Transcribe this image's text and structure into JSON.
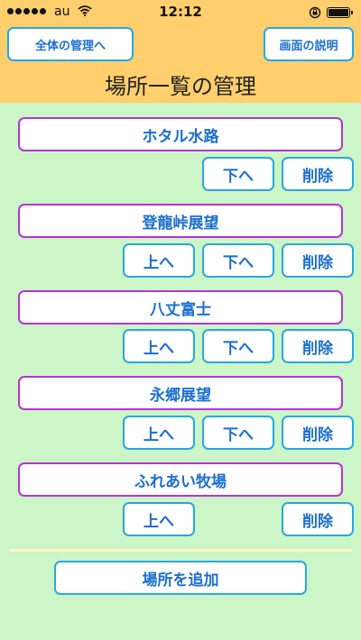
{
  "status_bar": {
    "carrier": "au",
    "time": "12:12",
    "battery_level": 1.0
  },
  "header": {
    "manage_all_button": "全体の管理へ",
    "screen_help_button": "画面の説明",
    "title": "場所一覧の管理"
  },
  "places": [
    {
      "name": "ホタル水路",
      "up_label": "",
      "down_label": "下へ",
      "delete_label": "削除"
    },
    {
      "name": "登龍峠展望",
      "up_label": "上へ",
      "down_label": "下へ",
      "delete_label": "削除"
    },
    {
      "name": "八丈富士",
      "up_label": "上へ",
      "down_label": "下へ",
      "delete_label": "削除"
    },
    {
      "name": "永郷展望",
      "up_label": "上へ",
      "down_label": "下へ",
      "delete_label": "削除"
    },
    {
      "name": "ふれあい牧場",
      "up_label": "上へ",
      "down_label": "",
      "delete_label": "削除"
    }
  ],
  "add_place_button": "場所を追加",
  "colors": {
    "header_bg": "#fecf6c",
    "page_bg": "#ccf5c8",
    "button_border": "#29a7e1",
    "place_border": "#b833d6",
    "text_blue": "#1b6fd1"
  }
}
